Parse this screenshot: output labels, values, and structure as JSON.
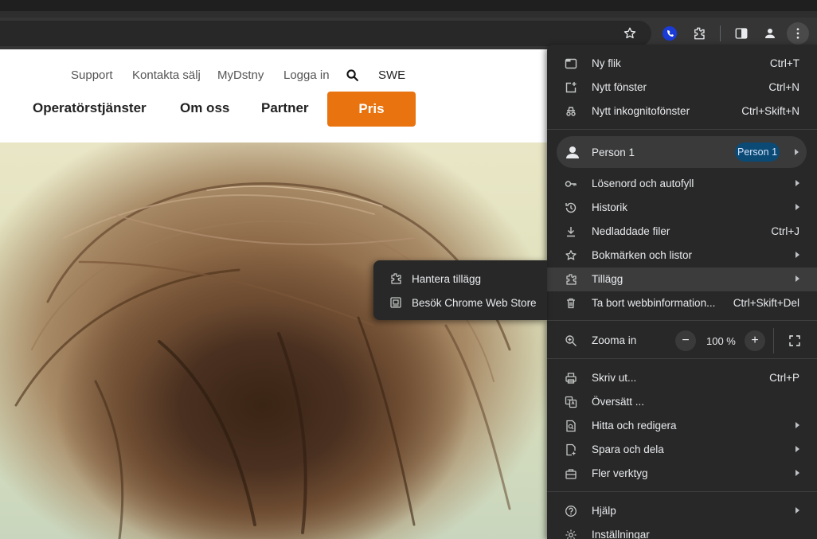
{
  "toolbar": {
    "icons": [
      "bookmark-star-icon",
      "extension-blue-icon",
      "extensions-puzzle-icon",
      "side-panel-icon",
      "profile-icon",
      "more-menu-icon"
    ]
  },
  "site": {
    "top_links": [
      "Support",
      "Kontakta sälj",
      "MyDstny",
      "Logga in"
    ],
    "language": "SWE",
    "nav": [
      "Operatörstjänster",
      "Om oss",
      "Partner"
    ],
    "cta": "Pris",
    "cta_color": "#e8730f"
  },
  "menu": {
    "new_tab": {
      "label": "Ny flik",
      "shortcut": "Ctrl+T"
    },
    "new_window": {
      "label": "Nytt fönster",
      "shortcut": "Ctrl+N"
    },
    "incognito": {
      "label": "Nytt inkognitofönster",
      "shortcut": "Ctrl+Skift+N"
    },
    "person": {
      "label": "Person 1",
      "chip": "Person 1"
    },
    "passwords": {
      "label": "Lösenord och autofyll"
    },
    "history": {
      "label": "Historik"
    },
    "downloads": {
      "label": "Nedladdade filer",
      "shortcut": "Ctrl+J"
    },
    "bookmarks": {
      "label": "Bokmärken och listor"
    },
    "extensions": {
      "label": "Tillägg"
    },
    "clear_data": {
      "label": "Ta bort webbinformation...",
      "shortcut": "Ctrl+Skift+Del"
    },
    "zoom": {
      "label": "Zooma in",
      "value": "100 %",
      "minus": "−",
      "plus": "+"
    },
    "print": {
      "label": "Skriv ut...",
      "shortcut": "Ctrl+P"
    },
    "translate": {
      "label": "Översätt ..."
    },
    "find": {
      "label": "Hitta och redigera"
    },
    "save_share": {
      "label": "Spara och dela"
    },
    "more_tools": {
      "label": "Fler verktyg"
    },
    "help": {
      "label": "Hjälp"
    },
    "settings": {
      "label": "Inställningar"
    }
  },
  "submenu": {
    "manage": {
      "label": "Hantera tillägg"
    },
    "webstore": {
      "label": "Besök Chrome Web Store"
    }
  },
  "colors": {
    "menu_bg": "#282828",
    "menu_text": "#e8eaed",
    "profile_chip": "#0b4a75",
    "highlight": "#3c3c3c"
  }
}
